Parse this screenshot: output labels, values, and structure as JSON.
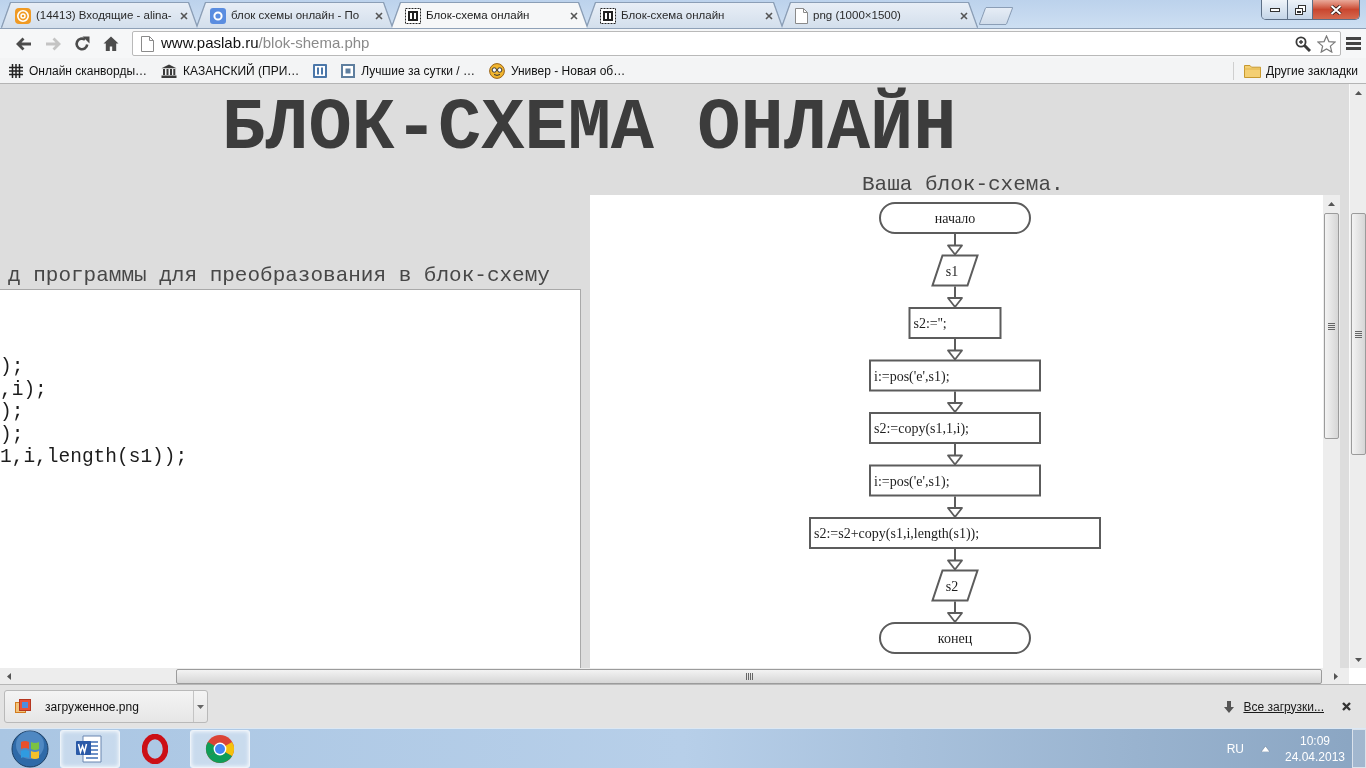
{
  "browser": {
    "tabs": [
      {
        "title": "(14413) Входящие - alina-",
        "kind": "mail",
        "selected": false
      },
      {
        "title": "блок схемы онлайн - По",
        "kind": "search",
        "selected": false
      },
      {
        "title": "Блок-схема онлайн",
        "kind": "site",
        "selected": true
      },
      {
        "title": "Блок-схема онлайн",
        "kind": "site",
        "selected": false
      },
      {
        "title": "png (1000×1500)",
        "kind": "page",
        "selected": false
      }
    ],
    "nav_buttons": [
      {
        "kind": "back",
        "disabled": false
      },
      {
        "kind": "forward",
        "disabled": true
      },
      {
        "kind": "reload",
        "disabled": false
      },
      {
        "kind": "home",
        "disabled": false
      }
    ],
    "address": {
      "host": "www.paslab.ru",
      "path": "/blok-shema.php"
    },
    "bookmarks": [
      {
        "kind": "grid",
        "label": "Онлайн сканворды…"
      },
      {
        "kind": "bank",
        "label": "КАЗАНСКИЙ (ПРИ…"
      },
      {
        "kind": "bars-tile"
      },
      {
        "kind": "square-tile",
        "label": "Лучшие за сутки / …"
      },
      {
        "kind": "smiley",
        "label": "Универ - Новая об…"
      }
    ],
    "other_bookmarks": "Другие закладки"
  },
  "page": {
    "heading": "БЛОК-СХЕМА ОНЛАЙН",
    "code_label": "д программы для преобразования в блок-схему",
    "code_lines": [
      ");",
      ",i);",
      ");",
      ");",
      "1,i,length(s1));"
    ],
    "result_label": "Ваша блок-схема.",
    "flowchart": {
      "nodes": [
        {
          "kind": "terminal",
          "text": "начало"
        },
        {
          "kind": "io",
          "text": "s1"
        },
        {
          "kind": "process",
          "text": "s2:='';"
        },
        {
          "kind": "process",
          "text": "i:=pos('e',s1);"
        },
        {
          "kind": "process",
          "text": "s2:=copy(s1,1,i);"
        },
        {
          "kind": "process",
          "text": "i:=pos('e',s1);"
        },
        {
          "kind": "process",
          "text": "s2:=s2+copy(s1,i,length(s1));"
        },
        {
          "kind": "io",
          "text": "s2"
        },
        {
          "kind": "terminal",
          "text": "конец"
        }
      ]
    }
  },
  "downloads": {
    "items": [
      {
        "filename": "загруженное.png"
      }
    ],
    "show_all": "Все загрузки..."
  },
  "taskbar": {
    "apps": [
      {
        "kind": "word",
        "running": true
      },
      {
        "kind": "opera",
        "running": false
      },
      {
        "kind": "chrome",
        "running": true
      }
    ],
    "language": "RU",
    "time": "10:09",
    "date": "24.04.2013"
  }
}
